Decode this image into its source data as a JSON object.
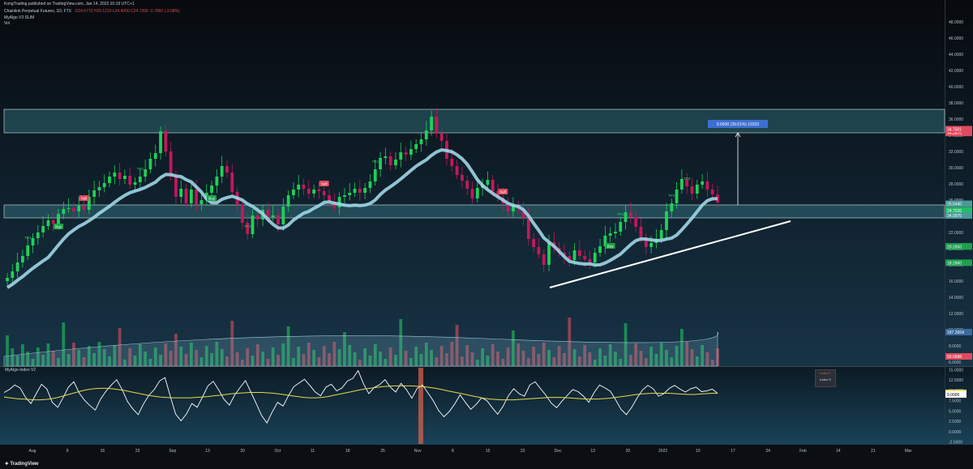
{
  "header": {
    "publisher": "KongTrading published on TradingView.com, Jan 14, 2022 10:19 UTC+1",
    "symbol": "Chainlink Perpetual Futures, 1D, FTX",
    "ohlc": "O24.6770 H25.1210 L24.4000 C24.7200 -0.7860 (-3.08%)",
    "indicator1": "MyAlgo V3 SLIM",
    "indicator2": "Vol"
  },
  "oscillator": {
    "title": "MyAlgo-Index V2",
    "legend_top": "Index P",
    "legend_bottom": "Index S"
  },
  "brand": "TradingView",
  "chart_data": [
    {
      "type": "candlestick",
      "title": "",
      "xlabel": "",
      "ylabel": "",
      "ylim": [
        5.5,
        49.5
      ],
      "x_tick_labels": [
        "Aug",
        "9",
        "16",
        "23",
        "Sep",
        "13",
        "20",
        "Oct",
        "11",
        "18",
        "25",
        "Nov",
        "8",
        "15",
        "22",
        "Dec",
        "13",
        "20",
        "2022",
        "10",
        "17",
        "24",
        "Feb",
        "14",
        "21",
        "Mar"
      ],
      "y_tick_labels": [
        "48.0000",
        "46.0000",
        "44.0000",
        "42.0000",
        "40.0000",
        "38.0000",
        "36.0000",
        "34.0000",
        "32.0000",
        "30.0000",
        "28.0000",
        "26.0000",
        "24.0000",
        "22.0000",
        "20.0000",
        "18.0000",
        "16.0000",
        "14.0000",
        "12.0000",
        "10.0000",
        "8.0000",
        "6.0000"
      ],
      "price_closes": [
        16.4,
        17.2,
        18.3,
        19.1,
        20.4,
        21.3,
        22.0,
        22.8,
        23.5,
        23.1,
        24.3,
        24.9,
        25.0,
        24.6,
        25.3,
        24.8,
        26.4,
        27.2,
        27.6,
        28.1,
        28.9,
        29.4,
        28.6,
        29.0,
        27.9,
        28.2,
        28.9,
        29.8,
        31.1,
        31.8,
        34.5,
        32.0,
        28.9,
        26.4,
        27.4,
        25.6,
        27.3,
        25.5,
        26.0,
        26.9,
        27.8,
        28.9,
        30.2,
        29.4,
        27.0,
        25.4,
        23.2,
        21.8,
        24.1,
        23.6,
        24.8,
        23.9,
        24.1,
        23.0,
        25.2,
        26.6,
        27.3,
        27.9,
        27.4,
        26.8,
        27.3,
        27.1,
        26.6,
        25.8,
        25.1,
        26.4,
        26.6,
        26.9,
        27.4,
        26.9,
        27.5,
        28.3,
        29.8,
        31.2,
        31.4,
        30.3,
        31.0,
        31.9,
        31.6,
        32.3,
        32.9,
        33.5,
        34.6,
        36.3,
        34.2,
        33.3,
        31.1,
        30.2,
        29.1,
        28.4,
        27.4,
        26.2,
        27.5,
        27.9,
        28.5,
        27.1,
        26.3,
        25.6,
        24.6,
        25.3,
        24.9,
        23.8,
        21.2,
        20.2,
        19.3,
        18.0,
        20.8,
        20.1,
        19.5,
        19.1,
        18.6,
        19.8,
        19.1,
        18.7,
        18.3,
        19.5,
        20.3,
        21.6,
        21.9,
        22.1,
        23.3,
        24.5,
        23.9,
        22.7,
        21.3,
        20.2,
        20.7,
        21.2,
        22.3,
        24.6,
        25.6,
        27.3,
        28.6,
        27.7,
        26.8,
        27.9,
        28.3,
        27.3,
        26.7,
        25.7
      ],
      "annotations": [
        "TP1",
        "TP2",
        "TP3",
        "Buy",
        "Sell",
        "9.6600 (39.01%) 19320"
      ],
      "price_labels": [
        {
          "text": "34.2870",
          "color": "#e04a5f"
        },
        {
          "text": "34.7501",
          "color": "#e04a5f"
        },
        {
          "text": "25.5440",
          "color": "#4a9a9a"
        },
        {
          "text": "24.7220",
          "color": "#1fbf5f"
        },
        {
          "text": "24.0975",
          "color": "#4a9a9a"
        },
        {
          "text": "20.2855",
          "color": "#1f9f4f"
        },
        {
          "text": "20.2650",
          "color": "#1f9f4f"
        },
        {
          "text": "18.2660",
          "color": "#1f9f4f"
        },
        {
          "text": "187.2664",
          "color": "#3b6aa0"
        },
        {
          "text": "50.0688",
          "color": "#e04a5f"
        }
      ],
      "zones": [
        {
          "from": 34.3,
          "to": 37.2
        },
        {
          "from": 23.8,
          "to": 25.4
        }
      ],
      "measure": {
        "from": 25.4,
        "to": 34.3,
        "label": "9.6600 (39.01%) 19320"
      },
      "trendline": {
        "from": 15.2,
        "to": 23.4
      }
    },
    {
      "type": "line",
      "title": "MyAlgo-Index V2",
      "ylim": [
        -3,
        15.5
      ],
      "y_tick_labels": [
        "15.0000",
        "12.5000",
        "10.0000",
        "7.5000",
        "5.0000",
        "2.5000",
        "0.0000",
        "-2.5000"
      ],
      "series": [
        {
          "name": "Index P",
          "values": [
            9.5,
            10.2,
            11.3,
            10.6,
            8.3,
            6.8,
            9.2,
            11.5,
            10.3,
            7.1,
            5.9,
            8.2,
            10.8,
            12.1,
            9.4,
            7.6,
            6.3,
            5.2,
            7.9,
            9.8,
            11.3,
            12.6,
            10.2,
            7.3,
            5.5,
            4.1,
            6.7,
            8.8,
            10.2,
            12.3,
            13.1,
            8.5,
            4.2,
            2.6,
            4.3,
            6.8,
            5.9,
            8.4,
            11.1,
            12.2,
            10.1,
            7.8,
            6.4,
            8.9,
            10.7,
            12.4,
            9.6,
            6.8,
            3.9,
            2.1,
            4.8,
            7.1,
            6.2,
            8.7,
            10.9,
            11.8,
            12.7,
            11.2,
            9.6,
            8.7,
            10.8,
            11.5,
            9.9,
            10.6,
            12.3,
            12.9,
            14.8,
            11.6,
            9.2,
            10.7,
            11.4,
            12.6,
            10.8,
            9.6,
            11.7,
            10.2,
            8.1,
            10.5,
            11.3,
            9.4,
            7.5,
            5.1,
            3.6,
            4.9,
            6.7,
            8.9,
            7.1,
            5.4,
            6.6,
            8.2,
            7.5,
            5.8,
            4.2,
            6.1,
            8.7,
            10.4,
            9.2,
            8.6,
            11.3,
            12.1,
            10.4,
            8.8,
            6.9,
            5.8,
            7.4,
            8.8,
            10.2,
            9.7,
            8.6,
            7.1,
            9.5,
            11.3,
            10.6,
            9.8,
            7.7,
            5.4,
            4.1,
            5.9,
            8.2,
            10.1,
            11.2,
            10.4,
            8.6,
            9.2,
            10.5,
            11.2,
            10.3,
            9.6,
            10.4,
            10.8,
            9.7,
            9.9,
            10.3,
            9.3
          ]
        },
        {
          "name": "Index S",
          "values": [
            8.4,
            8.2,
            8.0,
            7.9,
            7.8,
            7.7,
            7.7,
            7.8,
            8.0,
            8.3,
            8.7,
            9.1,
            9.5,
            9.9,
            10.2,
            10.4,
            10.5,
            10.5,
            10.4,
            10.2,
            10.0,
            9.7,
            9.4,
            9.1,
            8.8,
            8.6,
            8.4,
            8.3,
            8.2,
            8.2,
            8.2,
            8.2,
            8.3,
            8.4,
            8.5,
            8.7,
            8.8,
            9.0,
            9.2,
            9.3,
            9.4,
            9.5,
            9.5,
            9.5,
            9.4,
            9.3,
            9.1,
            8.9,
            8.7,
            8.5,
            8.3,
            8.2,
            8.2,
            8.3,
            8.5,
            8.8,
            9.1,
            9.4,
            9.7,
            10.0,
            10.3,
            10.5,
            10.7,
            10.9,
            11.0,
            11.1,
            11.1,
            11.1,
            11.1,
            11.0,
            10.9,
            10.7,
            10.5,
            10.2,
            9.9,
            9.6,
            9.3,
            9.0,
            8.7,
            8.4,
            8.1,
            7.9,
            7.8,
            7.7,
            7.7,
            7.7,
            7.8,
            7.9,
            8.0,
            8.1,
            8.2,
            8.3,
            8.3,
            8.3,
            8.2,
            8.1,
            8.0,
            7.9,
            7.9,
            7.9,
            8.0,
            8.1,
            8.3,
            8.5,
            8.7,
            8.9,
            9.1,
            9.2,
            9.3,
            9.3,
            9.3,
            9.3,
            9.2,
            9.1,
            9.0,
            9.0,
            9.1,
            9.2,
            9.3,
            9.3
          ]
        }
      ],
      "value_labels": [
        {
          "text": "9.3851",
          "color": "#f5e46a"
        },
        {
          "text": "9.0000",
          "color": "#ffffff"
        }
      ]
    }
  ]
}
